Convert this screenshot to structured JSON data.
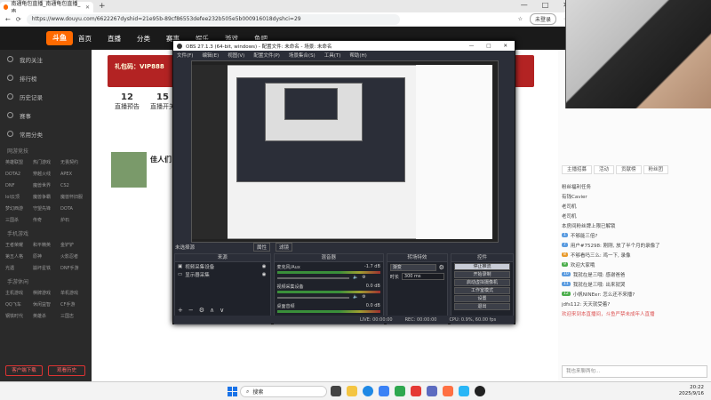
{
  "browser": {
    "tab_title": "南通龟包直播_南通龟包直播_南...",
    "new_tab": "+",
    "url": "https://www.douyu.com/6622267dyshid=21e95b-89cf86553defee232b505e5b000916018dyshci=29",
    "login_label": "未登录"
  },
  "site": {
    "logo": "斗鱼",
    "nav": [
      "首页",
      "直播",
      "分类",
      "赛事",
      "娱乐",
      "游戏",
      "鱼吧"
    ],
    "left_menu": [
      "我的关注",
      "排行榜",
      "历史记录",
      "赛事",
      "常用分类"
    ],
    "section_hot": "网游竞技",
    "hot_games": [
      "英雄联盟",
      "热门游戏",
      "无畏契约",
      "DOTA2",
      "穿越火线",
      "APEX",
      "DNF",
      "魔兽世界",
      "CS2",
      "lol云顶",
      "魔兽争霸",
      "魔兽怀旧服",
      "梦幻西游",
      "守望先锋",
      "DOTA",
      "三国杀",
      "传奇",
      "炉石"
    ],
    "section_mobile": "手机游戏",
    "mobile_games": [
      "王者荣耀",
      "和平精英",
      "金铲铲",
      "第五人格",
      "原神",
      "火影忍者",
      "光遇",
      "崩坏星铁",
      "DNF手游"
    ],
    "section_more": "手游休闲",
    "more_games": [
      "主机游戏",
      "棋牌游戏",
      "单机游戏",
      "QQ飞车",
      "休闲益智",
      "CF手游",
      "钢铁时代",
      "英雄杀",
      "三国志"
    ],
    "left_btn1": "客户端下载",
    "left_btn2": "观看历史",
    "banner_text": "礼包码：VIP888",
    "banner_title": "佳人们",
    "stats": [
      {
        "value": "12",
        "label": "直播预告"
      },
      {
        "value": "15",
        "label": "直播开关"
      }
    ]
  },
  "obs": {
    "title": "OBS 27.1.3 (64-bit, windows) - 配置文件: 未命名 - 场景: 未命名",
    "window_controls": [
      "—",
      "□",
      "✕"
    ],
    "menu": [
      "文件(F)",
      "编辑(E)",
      "视图(V)",
      "配置文件(P)",
      "场景集合(S)",
      "工具(T)",
      "帮助(H)"
    ],
    "scene_label": "未选择源",
    "props_label": "属性",
    "filters_label": "滤镜",
    "dock_sources": "来源",
    "dock_mixer": "混音器",
    "dock_transition": "转场特效",
    "dock_controls": "控件",
    "sources": [
      "视频采集设备",
      "显示器采集"
    ],
    "mixer": [
      {
        "name": "麦克风/Aux",
        "db": "-1.7 dB"
      },
      {
        "name": "视频采集设备",
        "db": "0.0 dB"
      },
      {
        "name": "桌面音频",
        "db": "0.0 dB"
      }
    ],
    "transition_name": "渐变",
    "duration_label": "时长",
    "duration_value": "300 ms",
    "controls": [
      "停止推流",
      "开始录制",
      "启动虚拟摄像机",
      "工作室模式",
      "设置",
      "退出"
    ],
    "scene_tabs": [
      "场景",
      "来源"
    ],
    "status": {
      "live": "LIVE: 00:00:00",
      "rec": "REC: 00:00:00",
      "cpu": "CPU: 0.9%, 60.00 fps"
    }
  },
  "chat": {
    "tabs": [
      "主播招募",
      "活动",
      "贡献榜",
      "粉丝团"
    ],
    "notice": "欢迎来到本直播间，斗鱼严禁未成年人直播",
    "lines": [
      {
        "badge": "",
        "text": "粉丝福利任务"
      },
      {
        "badge": "",
        "text": "有钱Cavier"
      },
      {
        "badge": "",
        "text": "老司机"
      },
      {
        "badge": "",
        "text": "老司机"
      },
      {
        "badge": "",
        "text": "本房间粉丝牌上限已解锁"
      },
      {
        "badge": "1",
        "text": "不够能三倍?"
      },
      {
        "badge": "7",
        "text": "用户#75298: 刚刚, 放了半个月的录像了"
      },
      {
        "badge": "8",
        "text": "不够看吗三么: 鸡一下, 录像"
      },
      {
        "badge": "9",
        "text": "欢迎大家哦"
      },
      {
        "badge": "10",
        "text": "我就在是三哦: 感谢爸爸"
      },
      {
        "badge": "11",
        "text": "我就在是三哦: 出来就哭"
      },
      {
        "badge": "12",
        "text": "小帆NINEer: 怎么还不来播?"
      },
      {
        "badge": "",
        "text": "jdfs112: 天天就受着?"
      }
    ],
    "input_placeholder": "我也来聊两句..."
  },
  "taskbar": {
    "search_placeholder": "搜索",
    "time": "20:22",
    "date": "2025/9/16"
  },
  "colors": {
    "accent": "#ff6a00",
    "obs_bg": "#2b2e38",
    "banner": "#b32323"
  }
}
